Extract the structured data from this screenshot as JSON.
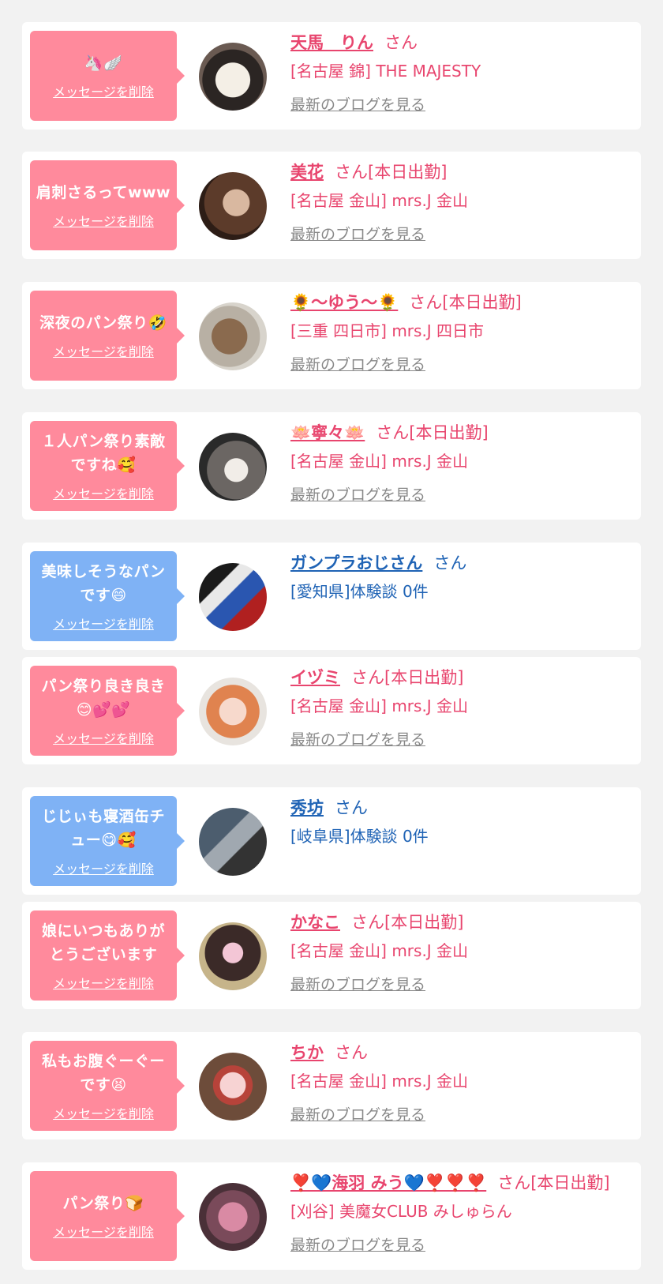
{
  "colors": {
    "pink_text": "#e8456e",
    "blue_text": "#1f63b5",
    "pink_bubble": "#ff8a9c",
    "blue_bubble": "#7fb2f5",
    "gray_link": "#888888"
  },
  "entries": [
    {
      "theme": "pink",
      "message": [
        "🦄🪽"
      ],
      "delete_label": "メッセージを削除",
      "name": "天馬　りん",
      "suffix": "さん",
      "shop": "[名古屋 錦] THE MAJESTY",
      "blog_link": "最新のブログを見る",
      "avatar_icon": "dog-plush-photo"
    },
    {
      "theme": "pink",
      "message": [
        "肩刺さるってwww"
      ],
      "delete_label": "メッセージを削除",
      "name": "美花",
      "suffix": "さん[本日出勤]",
      "shop": "[名古屋 金山] mrs.J 金山",
      "blog_link": "最新のブログを見る",
      "avatar_icon": "woman-photo"
    },
    {
      "theme": "pink",
      "message": [
        "深夜のパン祭り🤣"
      ],
      "delete_label": "メッセージを削除",
      "name": "🌻～ゆう～🌻",
      "suffix": "さん[本日出勤]",
      "shop": "[三重 四日市] mrs.J 四日市",
      "blog_link": "最新のブログを見る",
      "avatar_icon": "hair-photo"
    },
    {
      "theme": "pink",
      "message": [
        "１人パン祭り素敵",
        "ですね🥰"
      ],
      "delete_label": "メッセージを削除",
      "name": "🪷寧々🪷",
      "suffix": "さん[本日出勤]",
      "shop": "[名古屋 金山] mrs.J 金山",
      "blog_link": "最新のブログを見る",
      "avatar_icon": "woman-photo"
    },
    {
      "theme": "blue",
      "message": [
        "美味しそうなパン",
        "です😄"
      ],
      "delete_label": "メッセージを削除",
      "name": "ガンプラおじさん",
      "suffix": "さん",
      "shop": "[愛知県]体験談 0件",
      "blog_link": "",
      "avatar_icon": "robot-model-photo"
    },
    {
      "theme": "pink",
      "message": [
        "パン祭り良き良き",
        "😊💕💕"
      ],
      "delete_label": "メッセージを削除",
      "name": "イヅミ",
      "suffix": "さん[本日出勤]",
      "shop": "[名古屋 金山] mrs.J 金山",
      "blog_link": "最新のブログを見る",
      "avatar_icon": "woman-photo"
    },
    {
      "theme": "blue",
      "message": [
        "じじぃも寝酒缶チ",
        "ュー😋🥰"
      ],
      "delete_label": "メッセージを削除",
      "name": "秀坊",
      "suffix": "さん",
      "shop": "[岐阜県]体験談 0件",
      "blog_link": "",
      "avatar_icon": "man-photo"
    },
    {
      "theme": "pink",
      "message": [
        "娘にいつもありが",
        "とうございます"
      ],
      "delete_label": "メッセージを削除",
      "name": "かなこ",
      "suffix": "さん[本日出勤]",
      "shop": "[名古屋 金山] mrs.J 金山",
      "blog_link": "最新のブログを見る",
      "avatar_icon": "woman-photo"
    },
    {
      "theme": "pink",
      "message": [
        "私もお腹ぐーぐー",
        "です😫"
      ],
      "delete_label": "メッセージを削除",
      "name": "ちか",
      "suffix": "さん",
      "shop": "[名古屋 金山] mrs.J 金山",
      "blog_link": "最新のブログを見る",
      "avatar_icon": "heart-photo"
    },
    {
      "theme": "pink",
      "message": [
        "パン祭り🍞"
      ],
      "delete_label": "メッセージを削除",
      "name": "❣️💙海羽 みう💙❣️❣️❣️",
      "suffix": "さん[本日出勤]",
      "shop": "[刈谷] 美魔女CLUB みしゅらん",
      "blog_link": "最新のブログを見る",
      "avatar_icon": "blurred-woman-photo"
    }
  ]
}
